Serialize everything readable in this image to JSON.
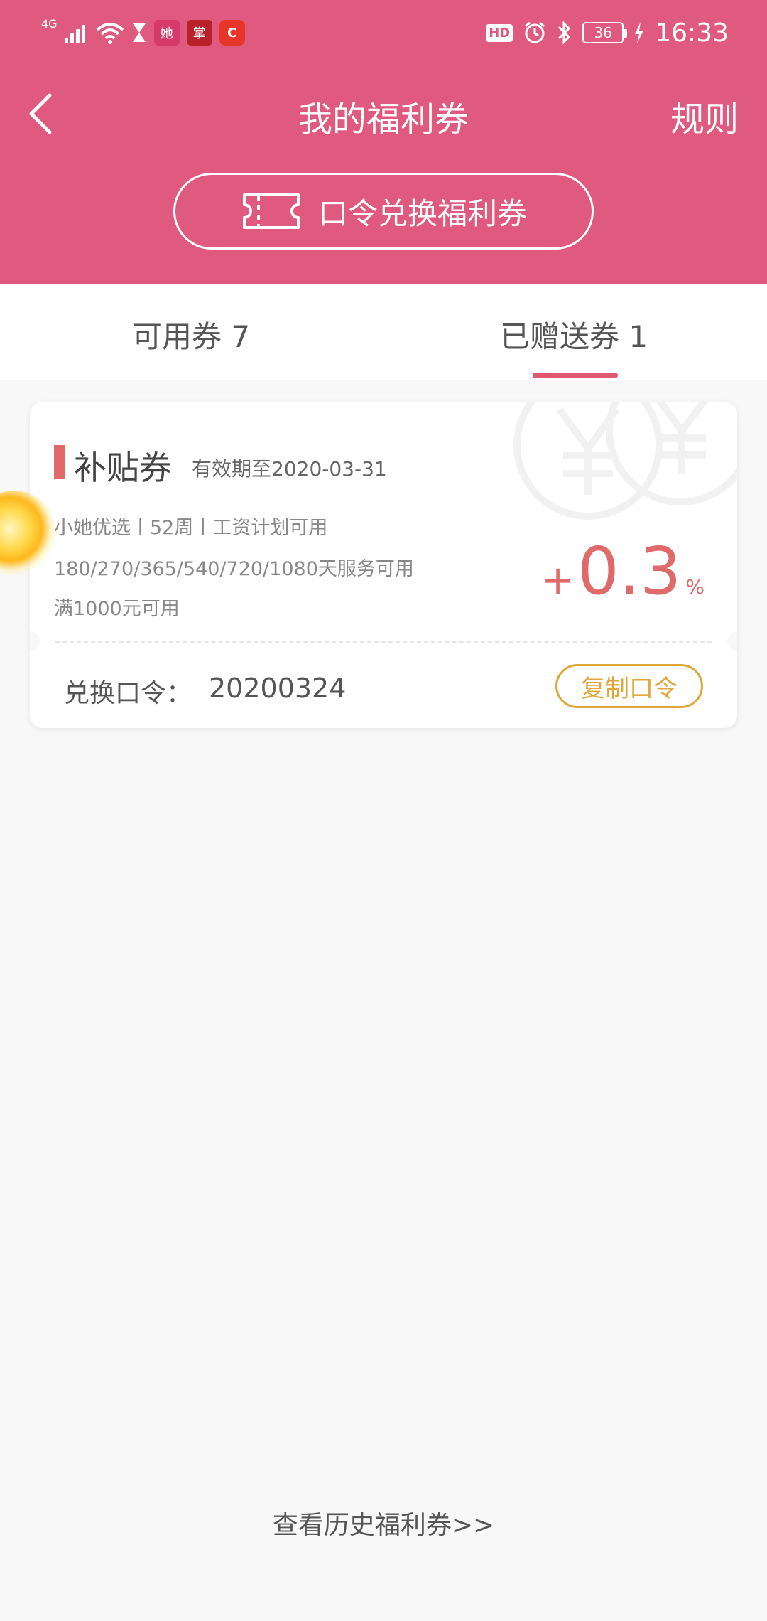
{
  "status_bar": {
    "network": "4G",
    "time": "16:33",
    "battery": "36",
    "hd_label": "HD",
    "app_icons": [
      "她",
      "掌",
      "C"
    ]
  },
  "header": {
    "title": "我的福利券",
    "rules_label": "规则",
    "redeem_label": "口令兑换福利券"
  },
  "tabs": [
    {
      "label": "可用券 7",
      "active": false
    },
    {
      "label": "已赠送券 1",
      "active": true
    }
  ],
  "coupon": {
    "type": "补贴券",
    "expiry": "有效期至2020-03-31",
    "line1": "小她优选丨52周丨工资计划可用",
    "line2": "180/270/365/540/720/1080天服务可用",
    "line3": "满1000元可用",
    "plus": "+",
    "amount": "0.3",
    "unit": "%",
    "code_label": "兑换口令：",
    "code_value": "20200324",
    "copy_label": "复制口令"
  },
  "footer": {
    "history_link": "查看历史福利券>>"
  },
  "colors": {
    "header_bg": "#e05a80",
    "accent_red": "#e06a6a",
    "copy_gold": "#e0a83a"
  }
}
